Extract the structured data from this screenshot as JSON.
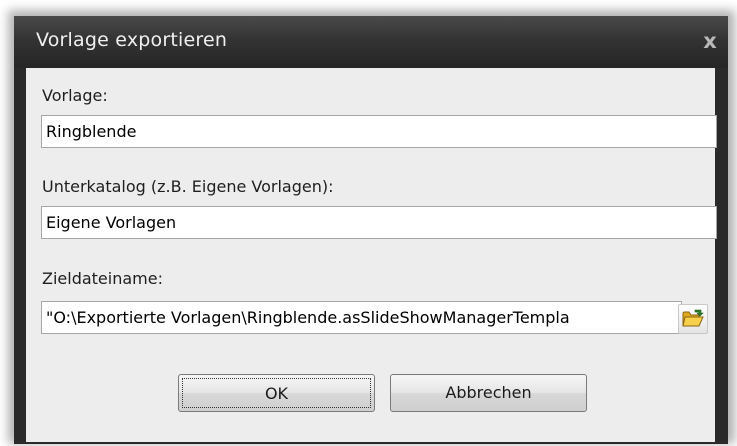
{
  "dialog": {
    "title": "Vorlage exportieren",
    "close_glyph": "x"
  },
  "fields": {
    "template_label": "Vorlage:",
    "template_value": "Ringblende",
    "subcatalog_label": "Unterkatalog (z.B. Eigene Vorlagen):",
    "subcatalog_value": "Eigene Vorlagen",
    "target_label": "Zieldateiname:",
    "target_value": "\"O:\\Exportierte Vorlagen\\Ringblende.asSlideShowManagerTempla"
  },
  "buttons": {
    "ok": "OK",
    "cancel": "Abbrechen"
  },
  "icons": {
    "browse": "open-folder-icon",
    "close": "close-icon"
  },
  "colors": {
    "titlebar": "#333333",
    "client": "#ededed",
    "folder": "#f2c233"
  }
}
